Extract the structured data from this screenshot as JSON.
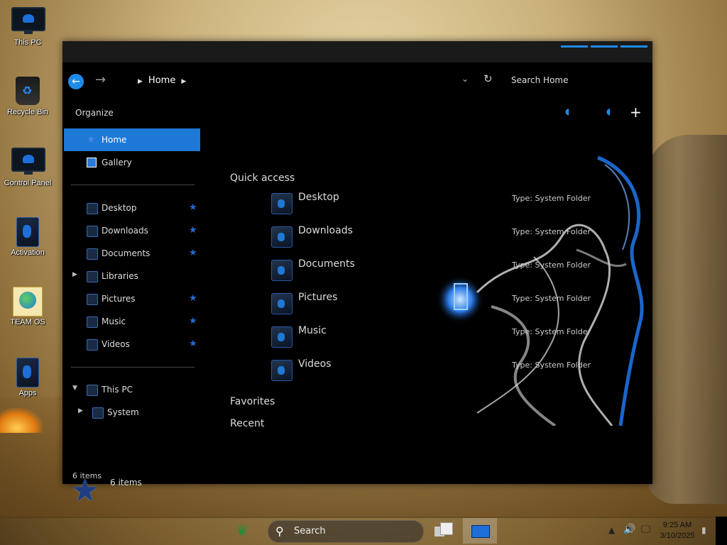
{
  "desktop": {
    "icons": [
      {
        "label": "This PC"
      },
      {
        "label": "Recycle Bin"
      },
      {
        "label": "Control Panel"
      },
      {
        "label": "Activation"
      },
      {
        "label": "TEAM OS"
      },
      {
        "label": "Apps"
      }
    ]
  },
  "window": {
    "breadcrumb": {
      "current": "Home"
    },
    "search_placeholder": "Search Home",
    "command": {
      "organize": "Organize"
    },
    "nav": {
      "home": "Home",
      "gallery": "Gallery",
      "quick": [
        "Desktop",
        "Downloads",
        "Documents",
        "Libraries",
        "Pictures",
        "Music",
        "Videos"
      ],
      "this_pc": "This PC",
      "system": "System"
    },
    "details_pane": {
      "count": "6 items"
    },
    "status": "6 items",
    "groups": {
      "quick_access": "Quick access",
      "favorites": "Favorites",
      "recent": "Recent"
    },
    "quick_access_items": [
      {
        "name": "Desktop",
        "type": "Type: System Folder"
      },
      {
        "name": "Downloads",
        "type": "Type: System Folder"
      },
      {
        "name": "Documents",
        "type": "Type: System Folder"
      },
      {
        "name": "Pictures",
        "type": "Type: System Folder"
      },
      {
        "name": "Music",
        "type": "Type: System Folder"
      },
      {
        "name": "Videos",
        "type": "Type: System Folder"
      }
    ]
  },
  "taskbar": {
    "search_label": "Search",
    "time": "9:25 AM",
    "date": "3/10/2025"
  },
  "colors": {
    "accent": "#1e78d6",
    "window_bg": "#000000"
  }
}
